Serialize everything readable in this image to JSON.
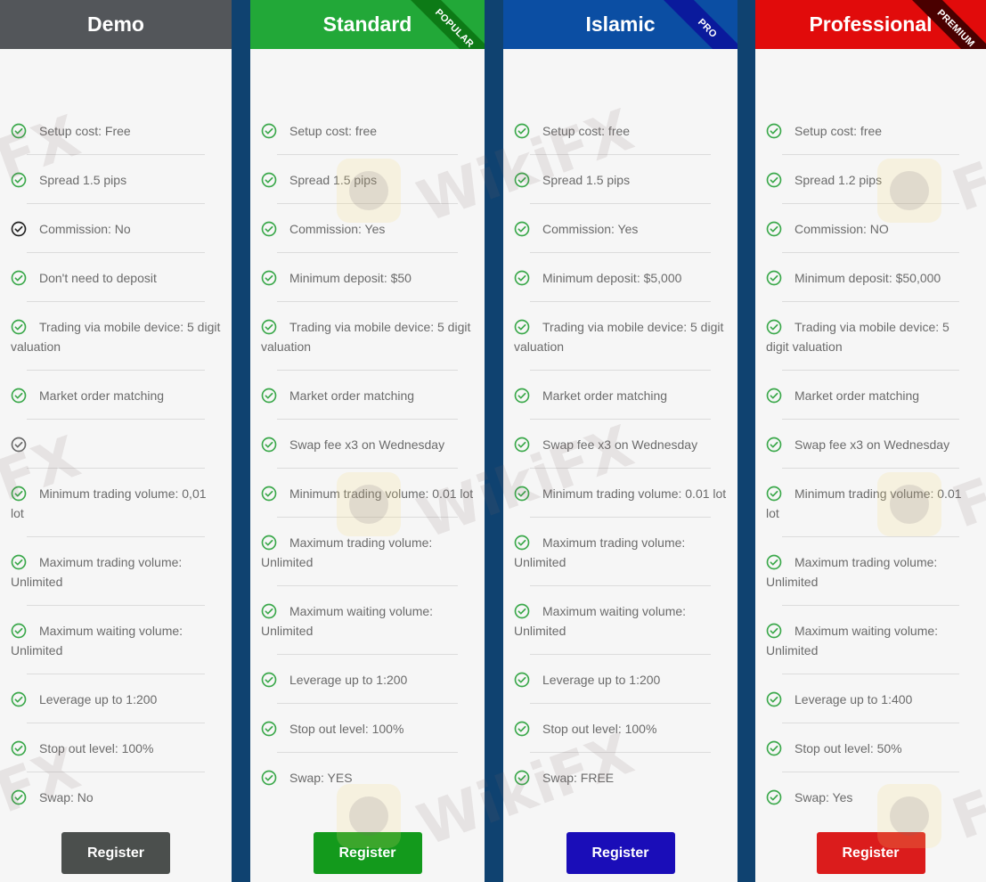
{
  "plans": [
    {
      "id": "demo",
      "title": "Demo",
      "ribbon": null,
      "header_color": "#53565a",
      "button_color": "#4b4f4d",
      "register_label": "Register",
      "features": [
        {
          "text": "Setup cost: Free",
          "icon": "check-circle-green"
        },
        {
          "text": "Spread 1.5 pips",
          "icon": "check-circle-green"
        },
        {
          "text": "Commission: No",
          "icon": "check-circle-black"
        },
        {
          "text": "Don't need to deposit",
          "icon": "check-circle-green"
        },
        {
          "text": "Trading via mobile device: 5 digit valuation",
          "icon": "check-circle-green"
        },
        {
          "text": "Market order matching",
          "icon": "check-circle-green"
        },
        {
          "text": "",
          "icon": "check-circle-gray"
        },
        {
          "text": "Minimum trading volume: 0,01 lot",
          "icon": "check-circle-green"
        },
        {
          "text": "Maximum trading volume: Unlimited",
          "icon": "check-circle-green"
        },
        {
          "text": "Maximum waiting volume: Unlimited",
          "icon": "check-circle-green"
        },
        {
          "text": "Leverage up to 1:200",
          "icon": "check-circle-green"
        },
        {
          "text": "Stop out level: 100%",
          "icon": "check-circle-green"
        },
        {
          "text": "Swap: No",
          "icon": "check-circle-green"
        }
      ]
    },
    {
      "id": "standard",
      "title": "Standard",
      "ribbon": "POPULAR",
      "ribbon_color": "#0d7a16",
      "header_color": "#22a838",
      "button_color": "#139a1c",
      "register_label": "Register",
      "features": [
        {
          "text": "Setup cost: free",
          "icon": "check-circle-green"
        },
        {
          "text": "Spread 1.5 pips",
          "icon": "check-circle-green"
        },
        {
          "text": "Commission: Yes",
          "icon": "check-circle-green"
        },
        {
          "text": "Minimum deposit: $50",
          "icon": "check-circle-green"
        },
        {
          "text": "Trading via mobile device: 5 digit valuation",
          "icon": "check-circle-green"
        },
        {
          "text": "Market order matching",
          "icon": "check-circle-green"
        },
        {
          "text": "Swap fee x3 on Wednesday",
          "icon": "check-circle-green"
        },
        {
          "text": "Minimum trading volume: 0.01 lot",
          "icon": "check-circle-green"
        },
        {
          "text": "Maximum trading volume: Unlimited",
          "icon": "check-circle-green"
        },
        {
          "text": "Maximum waiting volume: Unlimited",
          "icon": "check-circle-green"
        },
        {
          "text": "Leverage up to 1:200",
          "icon": "check-circle-green"
        },
        {
          "text": "Stop out level: 100%",
          "icon": "check-circle-green"
        },
        {
          "text": "Swap: YES",
          "icon": "check-circle-green"
        }
      ]
    },
    {
      "id": "islamic",
      "title": "Islamic",
      "ribbon": "PRO",
      "ribbon_color": "#0a1a9c",
      "header_color": "#0b4ea3",
      "button_color": "#1a0db8",
      "register_label": "Register",
      "features": [
        {
          "text": "Setup cost: free",
          "icon": "check-circle-green"
        },
        {
          "text": "Spread 1.5 pips",
          "icon": "check-circle-green"
        },
        {
          "text": "Commission: Yes",
          "icon": "check-circle-green"
        },
        {
          "text": "Minimum deposit: $5,000",
          "icon": "check-circle-green"
        },
        {
          "text": "Trading via mobile device: 5 digit valuation",
          "icon": "check-circle-green"
        },
        {
          "text": "Market order matching",
          "icon": "check-circle-green"
        },
        {
          "text": "Swap fee x3 on Wednesday",
          "icon": "check-circle-green"
        },
        {
          "text": "Minimum trading volume: 0.01 lot",
          "icon": "check-circle-green"
        },
        {
          "text": "Maximum trading volume: Unlimited",
          "icon": "check-circle-green"
        },
        {
          "text": "Maximum waiting volume: Unlimited",
          "icon": "check-circle-green"
        },
        {
          "text": "Leverage up to 1:200",
          "icon": "check-circle-green"
        },
        {
          "text": "Stop out level: 100%",
          "icon": "check-circle-green"
        },
        {
          "text": "Swap: FREE",
          "icon": "check-circle-green"
        }
      ]
    },
    {
      "id": "professional",
      "title": "Professional",
      "ribbon": "PREMIUM",
      "ribbon_color": "#4a0000",
      "header_color": "#e10b0b",
      "button_color": "#db1c1c",
      "register_label": "Register",
      "features": [
        {
          "text": "Setup cost: free",
          "icon": "check-circle-green"
        },
        {
          "text": "Spread 1.2 pips",
          "icon": "check-circle-green"
        },
        {
          "text": "Commission: NO",
          "icon": "check-circle-green"
        },
        {
          "text": "Minimum deposit: $50,000",
          "icon": "check-circle-green"
        },
        {
          "text": "Trading via mobile device: 5 digit valuation",
          "icon": "check-circle-green"
        },
        {
          "text": "Market order matching",
          "icon": "check-circle-green"
        },
        {
          "text": "Swap fee x3 on Wednesday",
          "icon": "check-circle-green"
        },
        {
          "text": "Minimum trading volume: 0.01 lot",
          "icon": "check-circle-green"
        },
        {
          "text": "Maximum trading volume: Unlimited",
          "icon": "check-circle-green"
        },
        {
          "text": "Maximum waiting volume: Unlimited",
          "icon": "check-circle-green"
        },
        {
          "text": "Leverage up to 1:400",
          "icon": "check-circle-green"
        },
        {
          "text": "Stop out level: 50%",
          "icon": "check-circle-green"
        },
        {
          "text": "Swap: Yes",
          "icon": "check-circle-green"
        }
      ]
    }
  ],
  "icon_colors": {
    "check-circle-green": "#3aa84a",
    "check-circle-black": "#222222",
    "check-circle-gray": "#6a6a6a"
  },
  "watermark": {
    "text": "WikiFX",
    "fragment": "FX"
  }
}
